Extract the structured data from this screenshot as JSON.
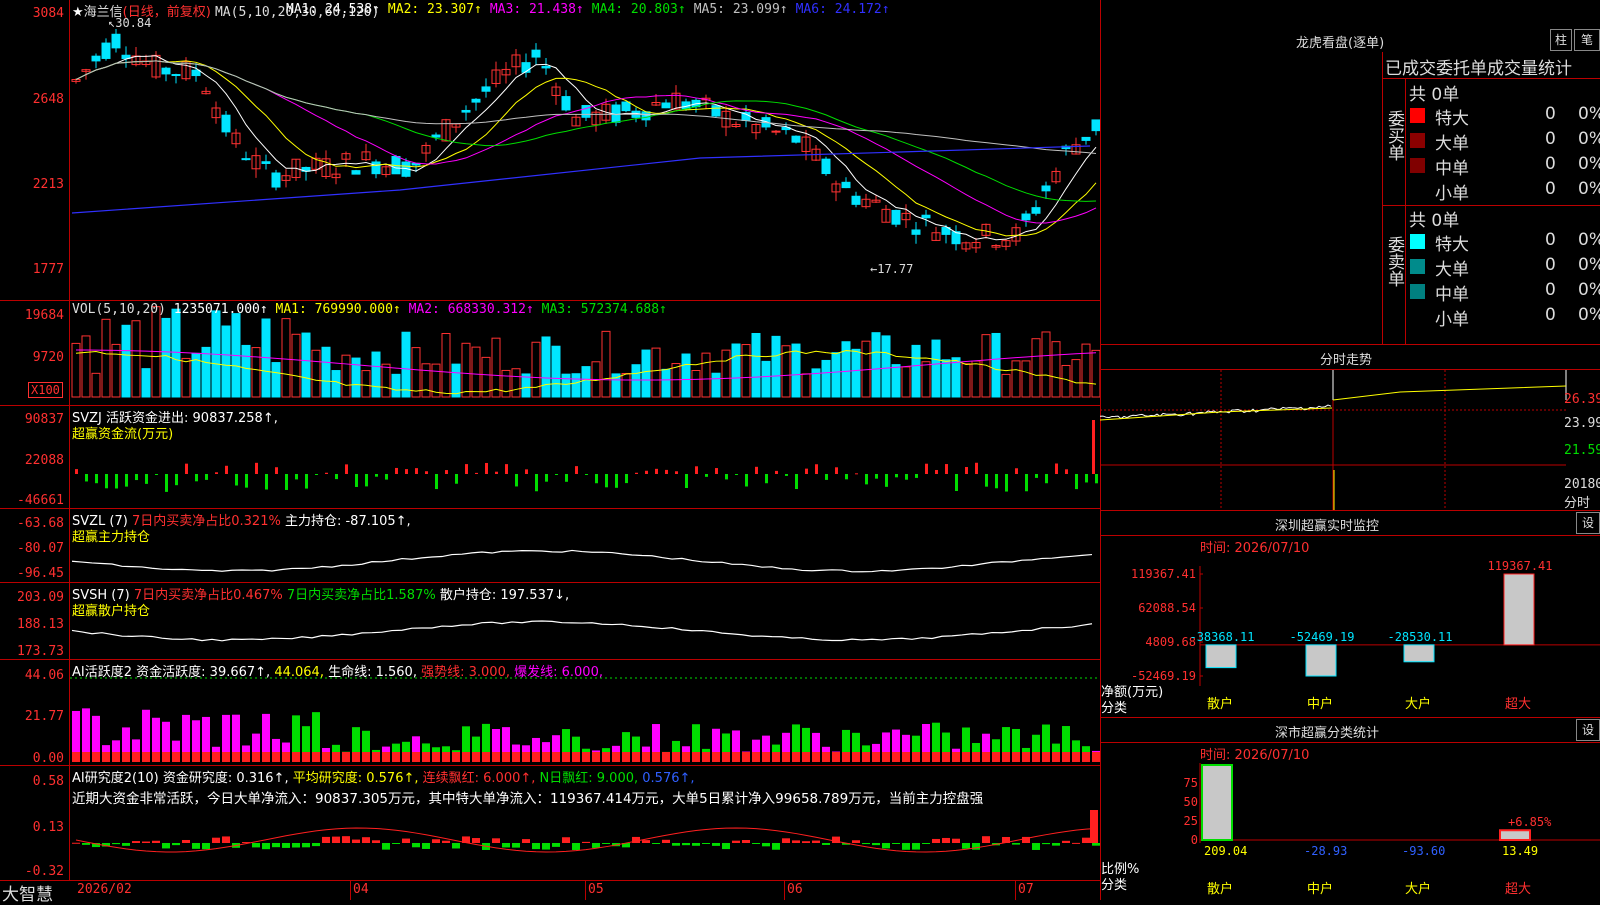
{
  "stock": {
    "name": "海兰信",
    "period": "(日线，前复权)",
    "star": "★"
  },
  "colors": {
    "up": "#ff3232",
    "down": "#00e5ff",
    "green": "#00dd00",
    "magenta": "#ff00ff",
    "yellow": "#ffff00",
    "grid": "#aa0000"
  },
  "main_panel": {
    "ma_header": "MA(5,10,20,30,60,120)",
    "ma": [
      {
        "label": "MA1:",
        "value": "24.538↑",
        "color": "#ffffff"
      },
      {
        "label": "MA2:",
        "value": "23.307↑",
        "color": "#ffff00"
      },
      {
        "label": "MA3:",
        "value": "21.438↑",
        "color": "#ff00ff"
      },
      {
        "label": "MA4:",
        "value": "20.803↑",
        "color": "#00dd00"
      },
      {
        "label": "MA5:",
        "value": "23.099↑",
        "color": "#c0c0c0"
      },
      {
        "label": "MA6:",
        "value": "24.172↑",
        "color": "#3030ff"
      }
    ],
    "y_ticks": [
      "3084",
      "2648",
      "2213",
      "1777"
    ],
    "high_marker": "30.84",
    "low_marker": "17.77"
  },
  "vol_panel": {
    "header": "VOL(5,10,20)",
    "vol": "1235071.000↑",
    "ma1": "MA1: 769990.000↑",
    "ma2": "MA2: 668330.312↑",
    "ma3": "MA3: 572374.688↑",
    "y_ticks": [
      "19684",
      "9720"
    ],
    "unit": "X100"
  },
  "svzj_panel": {
    "line1": "SVZJ  活跃资金进出: 90837.258↑,",
    "line2": "超赢资金流(万元)",
    "y_ticks": [
      "90837",
      "22088",
      "-46661"
    ]
  },
  "svzl_panel": {
    "prefix": "SVZL (7)",
    "part1": "7日内买卖净占比0.321%",
    "part2": "主力持仓: -87.105↑,",
    "line2": "超赢主力持仓",
    "y_ticks": [
      "-63.68",
      "-80.07",
      "-96.45"
    ]
  },
  "svsh_panel": {
    "prefix": "SVSH (7)",
    "part1": "7日内买卖净占比0.467%",
    "part2": "7日内买卖净占比1.587%",
    "part3": "散户持仓: 197.537↓,",
    "line2": "超赢散户持仓",
    "y_ticks": [
      "203.09",
      "188.13",
      "173.73"
    ]
  },
  "ai_active_panel": {
    "title": "AI活跃度2",
    "label": "资金活跃度:",
    "v1": "39.667↑,",
    "v2": "44.064,",
    "life": "生命线: 1.560,",
    "strong": "强势线: 3.000,",
    "burst": "爆发线: 6.000,",
    "y_ticks": [
      "44.06",
      "21.77",
      "0.00"
    ]
  },
  "ai_research_panel": {
    "title": "AI研究度2(10)",
    "label": "资金研究度: 0.316↑,",
    "avg": "平均研究度: 0.576↑,",
    "cont": "连续飘红: 6.000↑,",
    "nday": "N日飘红: 9.000,",
    "last": "0.576↑,",
    "summary": "近期大资金非常活跃，今日大单净流入：90837.305万元，其中特大单净流入：119367.414万元，大单5日累计净入99658.789万元，当前主力控盘强",
    "y_ticks": [
      "0.58",
      "0.13",
      "-0.32"
    ]
  },
  "x_axis": [
    "2026/02",
    "04",
    "05",
    "06",
    "07"
  ],
  "brand": "大智慧",
  "right": {
    "lhb_title": "龙虎看盘(逐单)",
    "btn_zhu": "柱",
    "btn_bi": "笔",
    "tabs": [
      "已成交",
      "委托单",
      "成交量统计"
    ],
    "buy": {
      "side": "委买单",
      "total": "共 0单",
      "rows": [
        {
          "name": "特大",
          "cnt": "0",
          "pct": "0%",
          "color": "#ff0000"
        },
        {
          "name": "大单",
          "cnt": "0",
          "pct": "0%",
          "color": "#8b0000"
        },
        {
          "name": "中单",
          "cnt": "0",
          "pct": "0%",
          "color": "#800000"
        },
        {
          "name": "小单",
          "cnt": "0",
          "pct": "0%",
          "color": "#000000"
        }
      ]
    },
    "sell": {
      "side": "委卖单",
      "total": "共 0单",
      "rows": [
        {
          "name": "特大",
          "cnt": "0",
          "pct": "0%",
          "color": "#00ffff"
        },
        {
          "name": "大单",
          "cnt": "0",
          "pct": "0%",
          "color": "#008b8b"
        },
        {
          "name": "中单",
          "cnt": "0",
          "pct": "0%",
          "color": "#008080"
        },
        {
          "name": "小单",
          "cnt": "0",
          "pct": "0%",
          "color": "#000000"
        }
      ]
    },
    "intraday": {
      "title": "分时走势",
      "y": [
        "26.39",
        "23.99",
        "21.59"
      ],
      "vol": "20180",
      "label": "分时"
    },
    "sz_monitor": {
      "title": "深圳超赢实时监控",
      "btn": "设",
      "time": "时间: 2026/07/10",
      "y": [
        "119367.41",
        "62088.54",
        "4809.68",
        "-52469.19"
      ],
      "bars": [
        {
          "cat": "散户",
          "val": -38368.11,
          "label": "-38368.11"
        },
        {
          "cat": "中户",
          "val": -52469.19,
          "label": "-52469.19"
        },
        {
          "cat": "大户",
          "val": -28530.11,
          "label": "-28530.11"
        },
        {
          "cat": "超大",
          "val": 119367.41,
          "label": "119367.41"
        }
      ],
      "ylabel": "净额(万元)",
      "xlabel": "分类"
    },
    "sz_class": {
      "title": "深市超赢分类统计",
      "btn": "设",
      "time": "时间: 2026/07/10",
      "y": [
        "75",
        "50",
        "25",
        "0"
      ],
      "bars": [
        {
          "cat": "散户",
          "val": "209.04",
          "pct": 100
        },
        {
          "cat": "中户",
          "val": "-28.93",
          "pct": 0
        },
        {
          "cat": "大户",
          "val": "-93.60",
          "pct": 0
        },
        {
          "cat": "超大",
          "val": "13.49",
          "pct": 13
        }
      ],
      "note": "+6.85%",
      "ylabel": "比例%",
      "xlabel": "分类"
    }
  }
}
